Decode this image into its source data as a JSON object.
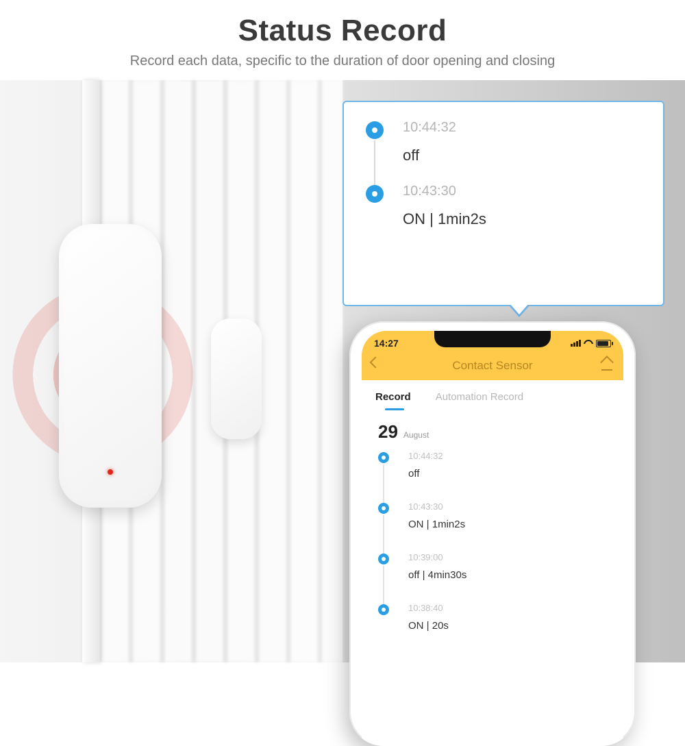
{
  "header": {
    "title": "Status Record",
    "subtitle": "Record each data, specific to the duration of door opening and closing"
  },
  "callout": {
    "items": [
      {
        "time": "10:44:32",
        "status": "off"
      },
      {
        "time": "10:43:30",
        "status": "ON  | 1min2s"
      }
    ]
  },
  "phone": {
    "status_bar": {
      "time": "14:27"
    },
    "app_title": "Contact Sensor",
    "tabs": {
      "active": "Record",
      "inactive": "Automation Record"
    },
    "date": {
      "day": "29",
      "month": "August"
    },
    "timeline": [
      {
        "time": "10:44:32",
        "status": "off"
      },
      {
        "time": "10:43:30",
        "status": "ON  | 1min2s"
      },
      {
        "time": "10:39:00",
        "status": "off  | 4min30s"
      },
      {
        "time": "10:38:40",
        "status": "ON  | 20s"
      }
    ]
  }
}
